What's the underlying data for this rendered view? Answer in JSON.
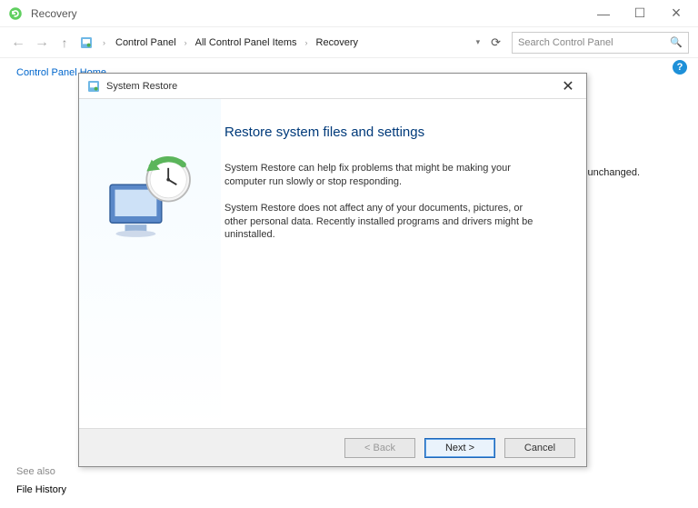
{
  "window": {
    "title": "Recovery"
  },
  "breadcrumb": {
    "items": [
      "Control Panel",
      "All Control Panel Items",
      "Recovery"
    ]
  },
  "search": {
    "placeholder": "Search Control Panel"
  },
  "left_nav": {
    "home": "Control Panel Home",
    "see_also": "See also",
    "file_history": "File History"
  },
  "background_fragment": "ic unchanged.",
  "dialog": {
    "title": "System Restore",
    "heading": "Restore system files and settings",
    "para1": "System Restore can help fix problems that might be making your computer run slowly or stop responding.",
    "para2": "System Restore does not affect any of your documents, pictures, or other personal data. Recently installed programs and drivers might be uninstalled.",
    "buttons": {
      "back": "< Back",
      "next": "Next >",
      "cancel": "Cancel"
    }
  }
}
